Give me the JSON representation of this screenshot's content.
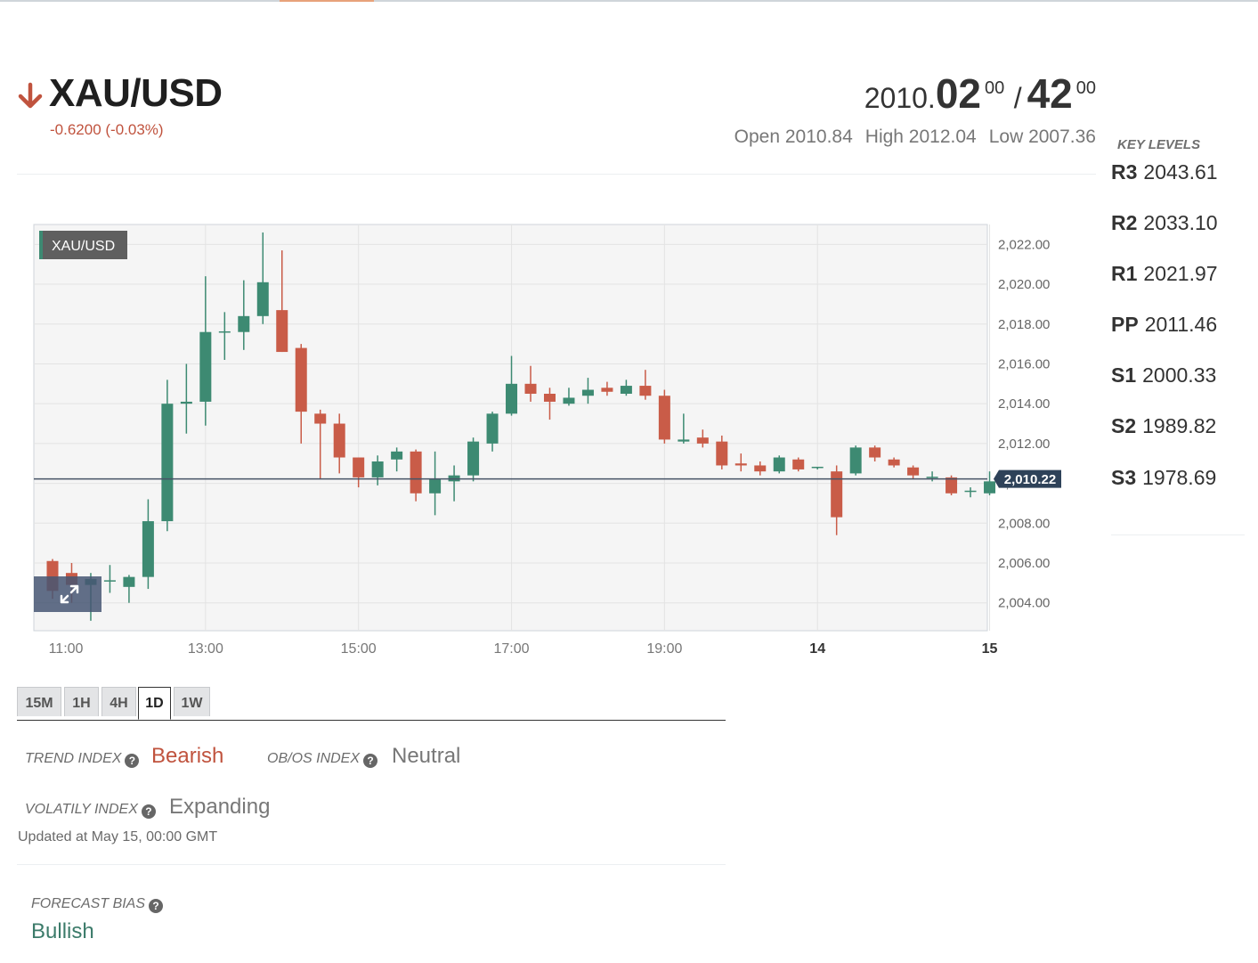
{
  "header": {
    "symbol": "XAU/USD",
    "change": "-0.6200 (-0.03%)",
    "direction": "down",
    "bid_prefix": "2010.",
    "bid_main": "02",
    "bid_sup": "00",
    "separator": "/",
    "ask_main": "42",
    "ask_sup": "00",
    "open": "Open 2010.84",
    "high": "High 2012.04",
    "low": "Low 2007.36"
  },
  "key_levels": {
    "title": "KEY LEVELS",
    "levels": [
      {
        "name": "R3",
        "value": "2043.61"
      },
      {
        "name": "R2",
        "value": "2033.10"
      },
      {
        "name": "R1",
        "value": "2021.97"
      },
      {
        "name": "PP",
        "value": "2011.46"
      },
      {
        "name": "S1",
        "value": "2000.33"
      },
      {
        "name": "S2",
        "value": "1989.82"
      },
      {
        "name": "S3",
        "value": "1978.69"
      }
    ]
  },
  "chart_data": {
    "type": "candlestick",
    "title": "XAU/USD",
    "ylim": [
      2002.6,
      2023.0
    ],
    "y_ticks": [
      "2,004.00",
      "2,006.00",
      "2,008.00",
      "2,010.00",
      "2,012.00",
      "2,014.00",
      "2,016.00",
      "2,018.00",
      "2,020.00",
      "2,022.00"
    ],
    "y_tick_values": [
      2004,
      2006,
      2008,
      2010,
      2012,
      2014,
      2016,
      2018,
      2020,
      2022
    ],
    "x_ticks": [
      {
        "index": 0.7,
        "label": "11:00",
        "bold": false
      },
      {
        "index": 8.0,
        "label": "13:00",
        "bold": false
      },
      {
        "index": 16.0,
        "label": "15:00",
        "bold": false
      },
      {
        "index": 24.0,
        "label": "17:00",
        "bold": false
      },
      {
        "index": 32.0,
        "label": "19:00",
        "bold": false
      },
      {
        "index": 40.0,
        "label": "14",
        "bold": true
      },
      {
        "index": 49.0,
        "label": "15",
        "bold": true
      }
    ],
    "current_price": 2010.22,
    "current_price_label": "2,010.22",
    "up_color": "#3d8a72",
    "down_color": "#c95c48",
    "grid": true,
    "candles": [
      {
        "o": 2006.1,
        "h": 2006.2,
        "l": 2004.2,
        "c": 2004.6
      },
      {
        "o": 2005.5,
        "h": 2006.0,
        "l": 2004.0,
        "c": 2004.9
      },
      {
        "o": 2004.9,
        "h": 2005.5,
        "l": 2003.1,
        "c": 2005.2
      },
      {
        "o": 2005.1,
        "h": 2005.9,
        "l": 2004.5,
        "c": 2005.1
      },
      {
        "o": 2004.8,
        "h": 2005.4,
        "l": 2004.0,
        "c": 2005.3
      },
      {
        "o": 2005.3,
        "h": 2009.2,
        "l": 2004.7,
        "c": 2008.1
      },
      {
        "o": 2008.1,
        "h": 2015.2,
        "l": 2007.6,
        "c": 2014.0
      },
      {
        "o": 2014.0,
        "h": 2016.0,
        "l": 2012.5,
        "c": 2014.1
      },
      {
        "o": 2014.1,
        "h": 2020.4,
        "l": 2012.9,
        "c": 2017.6
      },
      {
        "o": 2017.6,
        "h": 2018.6,
        "l": 2016.2,
        "c": 2017.6
      },
      {
        "o": 2017.6,
        "h": 2020.2,
        "l": 2016.7,
        "c": 2018.4
      },
      {
        "o": 2018.4,
        "h": 2022.6,
        "l": 2018.0,
        "c": 2020.1
      },
      {
        "o": 2018.7,
        "h": 2021.7,
        "l": 2016.6,
        "c": 2016.6
      },
      {
        "o": 2016.8,
        "h": 2017.0,
        "l": 2012.0,
        "c": 2013.6
      },
      {
        "o": 2013.5,
        "h": 2013.7,
        "l": 2010.2,
        "c": 2013.0
      },
      {
        "o": 2013.0,
        "h": 2013.5,
        "l": 2010.5,
        "c": 2011.3
      },
      {
        "o": 2011.3,
        "h": 2011.3,
        "l": 2009.8,
        "c": 2010.3
      },
      {
        "o": 2010.3,
        "h": 2011.4,
        "l": 2009.9,
        "c": 2011.1
      },
      {
        "o": 2011.2,
        "h": 2011.8,
        "l": 2010.6,
        "c": 2011.6
      },
      {
        "o": 2011.6,
        "h": 2011.7,
        "l": 2009.1,
        "c": 2009.5
      },
      {
        "o": 2009.5,
        "h": 2011.6,
        "l": 2008.4,
        "c": 2010.2
      },
      {
        "o": 2010.1,
        "h": 2010.9,
        "l": 2009.1,
        "c": 2010.4
      },
      {
        "o": 2010.4,
        "h": 2012.3,
        "l": 2010.1,
        "c": 2012.1
      },
      {
        "o": 2012.0,
        "h": 2013.6,
        "l": 2011.6,
        "c": 2013.5
      },
      {
        "o": 2013.5,
        "h": 2016.4,
        "l": 2013.4,
        "c": 2015.0
      },
      {
        "o": 2015.0,
        "h": 2015.9,
        "l": 2014.1,
        "c": 2014.5
      },
      {
        "o": 2014.5,
        "h": 2014.8,
        "l": 2013.2,
        "c": 2014.1
      },
      {
        "o": 2014.0,
        "h": 2014.8,
        "l": 2013.9,
        "c": 2014.3
      },
      {
        "o": 2014.4,
        "h": 2015.3,
        "l": 2014.0,
        "c": 2014.7
      },
      {
        "o": 2014.8,
        "h": 2015.1,
        "l": 2014.4,
        "c": 2014.6
      },
      {
        "o": 2014.5,
        "h": 2015.2,
        "l": 2014.4,
        "c": 2014.9
      },
      {
        "o": 2014.9,
        "h": 2015.7,
        "l": 2014.2,
        "c": 2014.4
      },
      {
        "o": 2014.4,
        "h": 2014.7,
        "l": 2012.0,
        "c": 2012.2
      },
      {
        "o": 2012.1,
        "h": 2013.5,
        "l": 2012.0,
        "c": 2012.2
      },
      {
        "o": 2012.3,
        "h": 2012.7,
        "l": 2011.8,
        "c": 2012.0
      },
      {
        "o": 2012.1,
        "h": 2012.4,
        "l": 2010.7,
        "c": 2010.9
      },
      {
        "o": 2011.0,
        "h": 2011.5,
        "l": 2010.6,
        "c": 2010.9
      },
      {
        "o": 2010.9,
        "h": 2011.1,
        "l": 2010.4,
        "c": 2010.6
      },
      {
        "o": 2010.6,
        "h": 2011.4,
        "l": 2010.5,
        "c": 2011.3
      },
      {
        "o": 2011.2,
        "h": 2011.3,
        "l": 2010.6,
        "c": 2010.7
      },
      {
        "o": 2010.8,
        "h": 2010.8,
        "l": 2010.7,
        "c": 2010.8
      },
      {
        "o": 2010.6,
        "h": 2010.9,
        "l": 2007.4,
        "c": 2008.3
      },
      {
        "o": 2010.5,
        "h": 2011.9,
        "l": 2010.4,
        "c": 2011.8
      },
      {
        "o": 2011.8,
        "h": 2011.9,
        "l": 2011.1,
        "c": 2011.3
      },
      {
        "o": 2011.2,
        "h": 2011.3,
        "l": 2010.8,
        "c": 2010.9
      },
      {
        "o": 2010.8,
        "h": 2010.9,
        "l": 2010.2,
        "c": 2010.4
      },
      {
        "o": 2010.3,
        "h": 2010.6,
        "l": 2010.1,
        "c": 2010.3
      },
      {
        "o": 2010.3,
        "h": 2010.4,
        "l": 2009.4,
        "c": 2009.5
      },
      {
        "o": 2009.6,
        "h": 2009.8,
        "l": 2009.3,
        "c": 2009.6
      },
      {
        "o": 2009.5,
        "h": 2010.6,
        "l": 2009.4,
        "c": 2010.1
      }
    ]
  },
  "timeframes": {
    "tabs": [
      "15M",
      "1H",
      "4H",
      "1D",
      "1W"
    ],
    "active": "1D"
  },
  "indicators": {
    "trend_label": "TREND INDEX",
    "trend_value": "Bearish",
    "obos_label": "OB/OS INDEX",
    "obos_value": "Neutral",
    "volatility_label": "VOLATILY INDEX",
    "volatility_value": "Expanding",
    "updated": "Updated at May 15, 00:00 GMT",
    "help_glyph": "?"
  },
  "forecast": {
    "label": "FORECAST BIAS",
    "value": "Bullish"
  },
  "colors": {
    "bearish": "#c0533e",
    "neutral": "#777777",
    "bullish": "#3c7b6a"
  }
}
